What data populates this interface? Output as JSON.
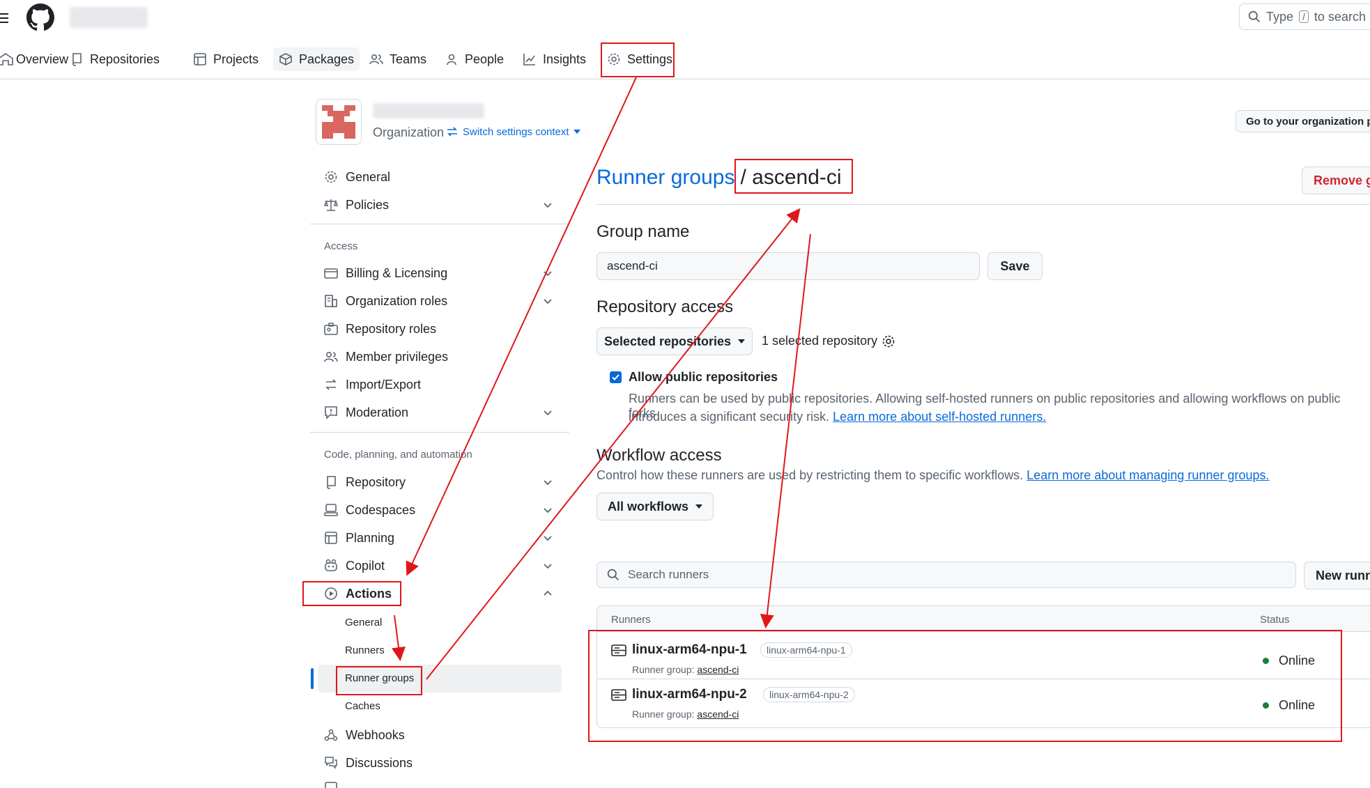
{
  "header": {
    "search_label": "Type",
    "search_key": "/",
    "search_suffix": "to search"
  },
  "nav": {
    "overview": "Overview",
    "repositories": "Repositories",
    "projects": "Projects",
    "packages": "Packages",
    "teams": "Teams",
    "people": "People",
    "insights": "Insights",
    "settings": "Settings"
  },
  "org": {
    "type": "Organization",
    "switch_context": "Switch settings context",
    "goto_button": "Go to your organization p"
  },
  "sidebar": {
    "general": "General",
    "policies": "Policies",
    "access_heading": "Access",
    "billing": "Billing & Licensing",
    "org_roles": "Organization roles",
    "repo_roles": "Repository roles",
    "member_privileges": "Member privileges",
    "import_export": "Import/Export",
    "moderation": "Moderation",
    "code_heading": "Code, planning, and automation",
    "repository": "Repository",
    "codespaces": "Codespaces",
    "planning": "Planning",
    "copilot": "Copilot",
    "actions": "Actions",
    "actions_general": "General",
    "actions_runners": "Runners",
    "actions_runner_groups": "Runner groups",
    "actions_caches": "Caches",
    "webhooks": "Webhooks",
    "discussions": "Discussions"
  },
  "main": {
    "breadcrumb_link": "Runner groups",
    "breadcrumb_current": "/ ascend-ci",
    "remove_button": "Remove gr",
    "group_name_heading": "Group name",
    "group_name_value": "ascend-ci",
    "save_button": "Save",
    "repo_access_heading": "Repository access",
    "repo_access_select": "Selected repositories",
    "repo_count": "1 selected repository",
    "allow_public_label": "Allow public repositories",
    "allow_public_desc_1": "Runners can be used by public repositories. Allowing self-hosted runners on public repositories and allowing workflows on public forks",
    "allow_public_desc_2": "introduces a significant security risk.",
    "allow_public_link": "Learn more about self-hosted runners.",
    "workflow_heading": "Workflow access",
    "workflow_desc": "Control how these runners are used by restricting them to specific workflows.",
    "workflow_link": "Learn more about managing runner groups.",
    "workflow_select": "All workflows",
    "search_placeholder": "Search runners",
    "new_runner_button": "New runn",
    "table": {
      "col_runners": "Runners",
      "col_status": "Status",
      "rows": [
        {
          "name": "linux-arm64-npu-1",
          "label": "linux-arm64-npu-1",
          "group_prefix": "Runner group:",
          "group": "ascend-ci",
          "status": "Online"
        },
        {
          "name": "linux-arm64-npu-2",
          "label": "linux-arm64-npu-2",
          "group_prefix": "Runner group:",
          "group": "ascend-ci",
          "status": "Online"
        }
      ]
    }
  },
  "colors": {
    "accent": "#0969da",
    "online": "#1a7f37",
    "danger": "#d1242f",
    "annotation": "#e0161a"
  }
}
